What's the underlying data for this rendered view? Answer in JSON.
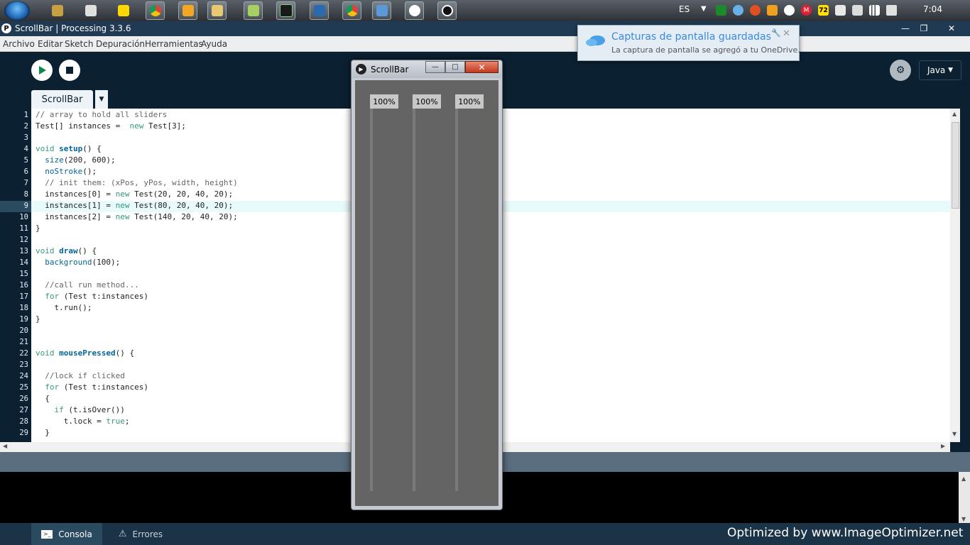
{
  "taskbar": {
    "language": "ES",
    "clock": "7:04",
    "tray_badge": "72",
    "tray_m": "M"
  },
  "window": {
    "title": "ScrollBar | Processing 3.3.6",
    "app_icon": "P",
    "minimize": "—",
    "maximize": "❐",
    "close": "✕"
  },
  "menu": [
    "Archivo",
    "Editar",
    "Sketch",
    "Depuración",
    "Herramientas",
    "Ayuda"
  ],
  "toolbar": {
    "mode_label": "Java",
    "mode_arrow": "▼",
    "debug_icon": "⚙"
  },
  "tabs": {
    "active": "ScrollBar",
    "arrow": "▼"
  },
  "editor": {
    "line_numbers": [
      "1",
      "2",
      "3",
      "4",
      "5",
      "6",
      "7",
      "8",
      "9",
      "10",
      "11",
      "12",
      "13",
      "14",
      "15",
      "16",
      "17",
      "18",
      "19",
      "20",
      "21",
      "22",
      "23",
      "24",
      "25",
      "26",
      "27",
      "28",
      "29"
    ]
  },
  "bottom": {
    "console_tab": "Consola",
    "errors_tab": "Errores",
    "watermark": "Optimized by www.ImageOptimizer.net"
  },
  "sketch": {
    "title": "ScrollBar",
    "min": "—",
    "max": "□",
    "close": "✕",
    "handles": [
      "100%",
      "100%",
      "100%"
    ]
  },
  "notification": {
    "title": "Capturas de pantalla guardadas",
    "message": "La captura de pantalla se agregó a tu OneDrive.",
    "close": "✕",
    "pin": "🔧"
  }
}
